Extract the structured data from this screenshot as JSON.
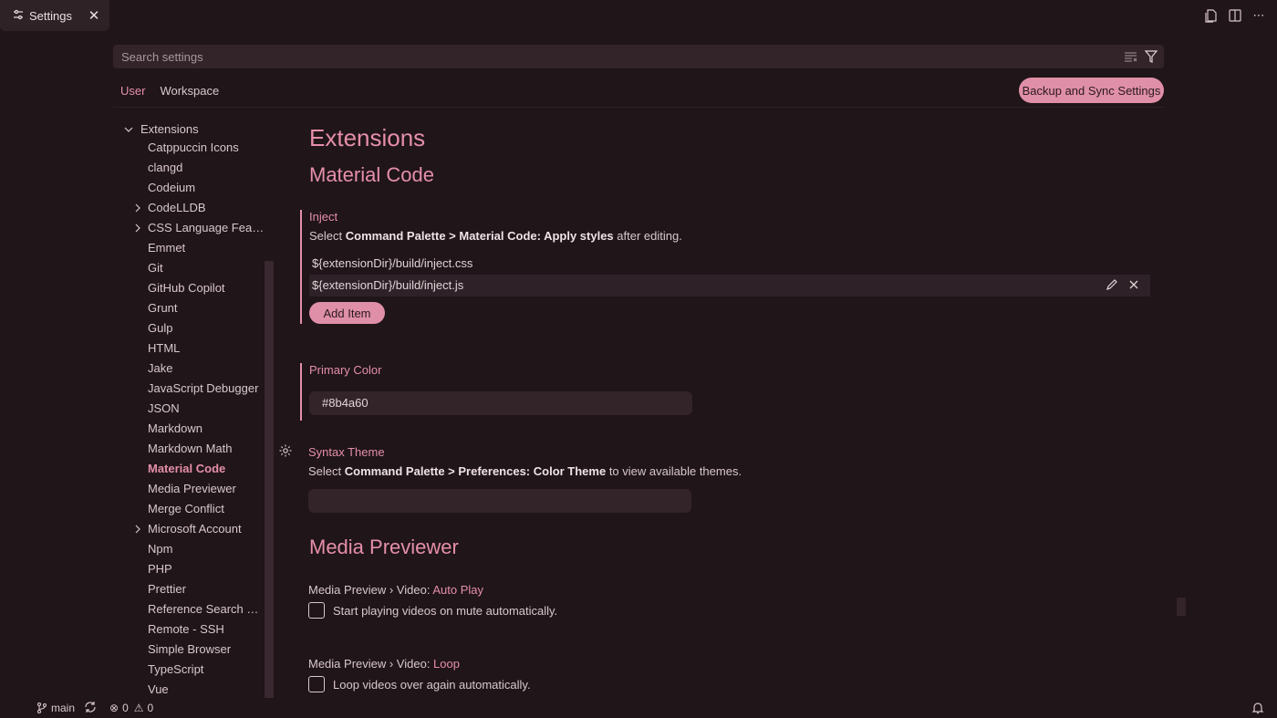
{
  "tab": {
    "title": "Settings"
  },
  "search": {
    "placeholder": "Search settings"
  },
  "scope_tabs": [
    "User",
    "Workspace"
  ],
  "backup_button": "Backup and Sync Settings",
  "toc": {
    "header": "Extensions",
    "items": [
      {
        "label": "Catppuccin Icons",
        "expandable": false
      },
      {
        "label": "clangd",
        "expandable": false
      },
      {
        "label": "Codeium",
        "expandable": false
      },
      {
        "label": "CodeLLDB",
        "expandable": true
      },
      {
        "label": "CSS Language Featur...",
        "expandable": true
      },
      {
        "label": "Emmet",
        "expandable": false
      },
      {
        "label": "Git",
        "expandable": false
      },
      {
        "label": "GitHub Copilot",
        "expandable": false
      },
      {
        "label": "Grunt",
        "expandable": false
      },
      {
        "label": "Gulp",
        "expandable": false
      },
      {
        "label": "HTML",
        "expandable": false
      },
      {
        "label": "Jake",
        "expandable": false
      },
      {
        "label": "JavaScript Debugger",
        "expandable": false
      },
      {
        "label": "JSON",
        "expandable": false
      },
      {
        "label": "Markdown",
        "expandable": false
      },
      {
        "label": "Markdown Math",
        "expandable": false
      },
      {
        "label": "Material Code",
        "expandable": false,
        "active": true
      },
      {
        "label": "Media Previewer",
        "expandable": false
      },
      {
        "label": "Merge Conflict",
        "expandable": false
      },
      {
        "label": "Microsoft Account",
        "expandable": true
      },
      {
        "label": "Npm",
        "expandable": false
      },
      {
        "label": "PHP",
        "expandable": false
      },
      {
        "label": "Prettier",
        "expandable": false
      },
      {
        "label": "Reference Search View",
        "expandable": false
      },
      {
        "label": "Remote - SSH",
        "expandable": false
      },
      {
        "label": "Simple Browser",
        "expandable": false
      },
      {
        "label": "TypeScript",
        "expandable": false
      },
      {
        "label": "Vue",
        "expandable": false
      }
    ]
  },
  "main": {
    "heading": "Extensions",
    "section": "Material Code",
    "inject": {
      "title": "Inject",
      "desc_pre": "Select ",
      "desc_bold": "Command Palette > Material Code: Apply styles",
      "desc_post": " after editing.",
      "items": [
        "${extensionDir}/build/inject.css",
        "${extensionDir}/build/inject.js"
      ],
      "add_label": "Add Item"
    },
    "primary_color": {
      "title": "Primary Color",
      "value": "#8b4a60"
    },
    "syntax_theme": {
      "title": "Syntax Theme",
      "desc_pre": "Select ",
      "desc_bold": "Command Palette > Preferences: Color Theme",
      "desc_post": " to view available themes.",
      "value": ""
    },
    "media_section": "Media Previewer",
    "autoplay": {
      "category": "Media Preview › Video: ",
      "name": "Auto Play",
      "desc": "Start playing videos on mute automatically.",
      "checked": false
    },
    "loop": {
      "category": "Media Preview › Video: ",
      "name": "Loop",
      "desc": "Loop videos over again automatically.",
      "checked": false
    }
  },
  "status": {
    "branch": "main",
    "errors": "0",
    "warnings": "0"
  },
  "colors": {
    "accent": "#e58fa9",
    "background": "#201519",
    "button": "#e08fa8"
  }
}
